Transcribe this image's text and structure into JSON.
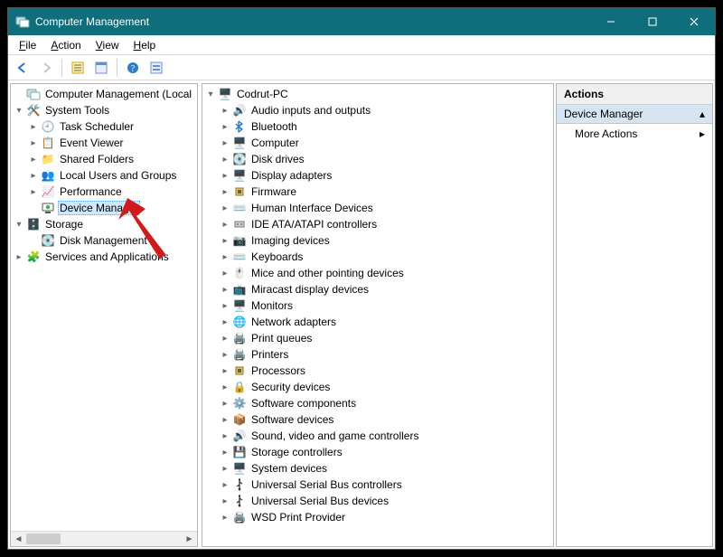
{
  "window": {
    "title": "Computer Management"
  },
  "menu": {
    "file": "File",
    "action": "Action",
    "view": "View",
    "help": "Help"
  },
  "leftTree": {
    "root": "Computer Management (Local",
    "systemTools": "System Tools",
    "taskScheduler": "Task Scheduler",
    "eventViewer": "Event Viewer",
    "sharedFolders": "Shared Folders",
    "localUsers": "Local Users and Groups",
    "performance": "Performance",
    "deviceManager": "Device Manager",
    "storage": "Storage",
    "diskManagement": "Disk Management",
    "services": "Services and Applications"
  },
  "centerTree": {
    "root": "Codrut-PC",
    "items": [
      "Audio inputs and outputs",
      "Bluetooth",
      "Computer",
      "Disk drives",
      "Display adapters",
      "Firmware",
      "Human Interface Devices",
      "IDE ATA/ATAPI controllers",
      "Imaging devices",
      "Keyboards",
      "Mice and other pointing devices",
      "Miracast display devices",
      "Monitors",
      "Network adapters",
      "Print queues",
      "Printers",
      "Processors",
      "Security devices",
      "Software components",
      "Software devices",
      "Sound, video and game controllers",
      "Storage controllers",
      "System devices",
      "Universal Serial Bus controllers",
      "Universal Serial Bus devices",
      "WSD Print Provider"
    ]
  },
  "iconMap": {
    "Audio inputs and outputs": "🔊",
    "Bluetooth": "bt",
    "Computer": "🖥️",
    "Disk drives": "💽",
    "Display adapters": "🖥️",
    "Firmware": "chip",
    "Human Interface Devices": "⌨️",
    "IDE ATA/ATAPI controllers": "ide",
    "Imaging devices": "📷",
    "Keyboards": "⌨️",
    "Mice and other pointing devices": "🖱️",
    "Miracast display devices": "📺",
    "Monitors": "🖥️",
    "Network adapters": "🌐",
    "Print queues": "🖨️",
    "Printers": "🖨️",
    "Processors": "chip",
    "Security devices": "🔒",
    "Software components": "⚙️",
    "Software devices": "📦",
    "Sound, video and game controllers": "🔊",
    "Storage controllers": "💾",
    "System devices": "🖥️",
    "Universal Serial Bus controllers": "usb",
    "Universal Serial Bus devices": "usb",
    "WSD Print Provider": "🖨️"
  },
  "actions": {
    "header": "Actions",
    "subheader": "Device Manager",
    "more": "More Actions"
  }
}
